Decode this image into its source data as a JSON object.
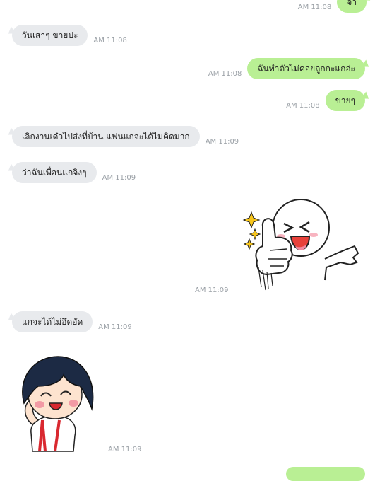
{
  "messages": [
    {
      "text": "จ้า",
      "time": "AM 11:08"
    },
    {
      "text": "วันเสาๆ ขายปะ",
      "time": "AM 11:08"
    },
    {
      "text": "ฉันทำตัวไม่ค่อยถูกกะแกอ่ะ",
      "time": "AM 11:08"
    },
    {
      "text": "ขายๆ",
      "time": "AM 11:08"
    },
    {
      "text": "เลิกงานเด๋วไปส่งที่บ้าน แฟนแกจะได้ไม่คิดมาก",
      "time": "AM 11:09"
    },
    {
      "text": "ว่าฉันเพื่อนแกจิงๆ",
      "time": "AM 11:09"
    },
    {
      "text": "แกจะได้ไม่อึดอัด",
      "time": "AM 11:09"
    }
  ],
  "stickers": [
    {
      "icon": "thumbs-up-line-character-sticker",
      "time": "AM 11:09"
    },
    {
      "icon": "smiling-girl-character-sticker",
      "time": "AM 11:09"
    }
  ],
  "colors": {
    "incoming_bubble": "#e8eaed",
    "outgoing_bubble": "#b9ef94",
    "timestamp": "#9aa0a6",
    "background": "#ffffff"
  }
}
